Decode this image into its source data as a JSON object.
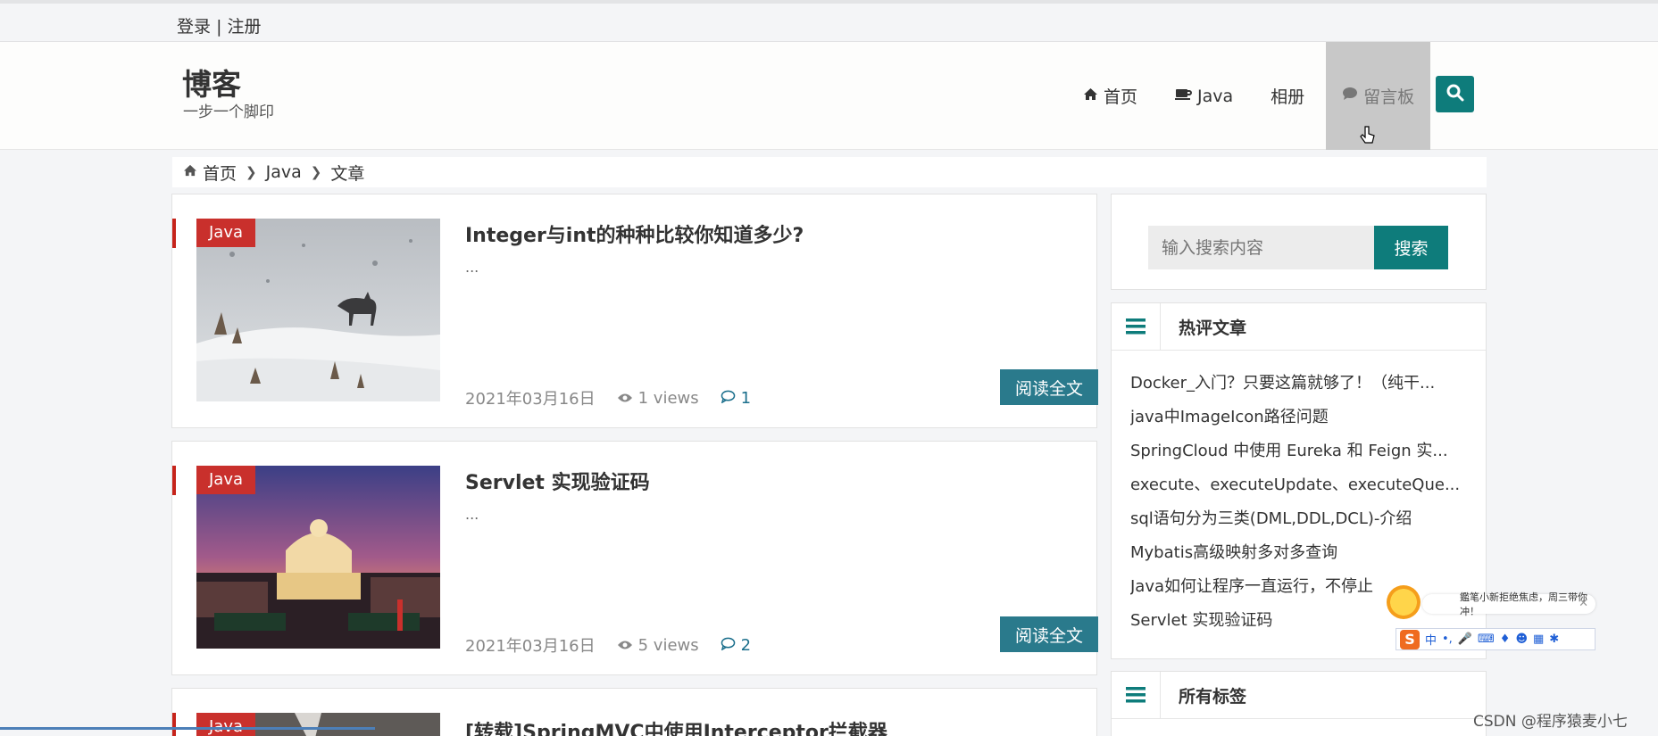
{
  "topbar": {
    "login": "登录",
    "divider": "|",
    "register": "注册"
  },
  "brand": {
    "title": "博客",
    "subtitle": "一步一个脚印"
  },
  "nav": {
    "items": [
      {
        "label": "首页",
        "icon": "home-icon"
      },
      {
        "label": "Java",
        "icon": "coffee-icon"
      },
      {
        "label": "相册",
        "icon": ""
      },
      {
        "label": "留言板",
        "icon": "comment-icon"
      }
    ],
    "active_index": 3
  },
  "breadcrumb": {
    "home": "首页",
    "category": "Java",
    "current": "文章"
  },
  "articles": [
    {
      "tag": "Java",
      "title": "Integer与int的种种比较你知道多少?",
      "excerpt": "...",
      "date": "2021年03月16日",
      "views": "1 views",
      "comments": "1",
      "read_more": "阅读全文"
    },
    {
      "tag": "Java",
      "title": "Servlet 实现验证码",
      "excerpt": "...",
      "date": "2021年03月16日",
      "views": "5 views",
      "comments": "2",
      "read_more": "阅读全文"
    },
    {
      "tag": "Java",
      "title": "[转载]SpringMVC中使用Interceptor拦截器"
    }
  ],
  "sidebar": {
    "search": {
      "placeholder": "输入搜索内容",
      "button": "搜索"
    },
    "hot": {
      "title": "热评文章",
      "items": [
        "Docker_入门？只要这篇就够了！（纯干...",
        "java中ImageIcon路径问题",
        "SpringCloud 中使用 Eureka 和 Feign 实...",
        "execute、executeUpdate、executeQue...",
        "sql语句分为三类(DML,DDL,DCL)-介绍",
        "Mybatis高级映射多对多查询",
        "Java如何让程序一直运行，不停止",
        "Servlet 实现验证码"
      ]
    },
    "tags": {
      "title": "所有标签"
    }
  },
  "ime": {
    "tip": "鑑笔小新拒绝焦虑，周三带你冲！",
    "lang": "中"
  },
  "watermark": "CSDN @程序猿麦小七",
  "colors": {
    "accent": "#0e7c7b",
    "tag_red": "#c9302c",
    "read_btn": "#2a7a8c"
  }
}
